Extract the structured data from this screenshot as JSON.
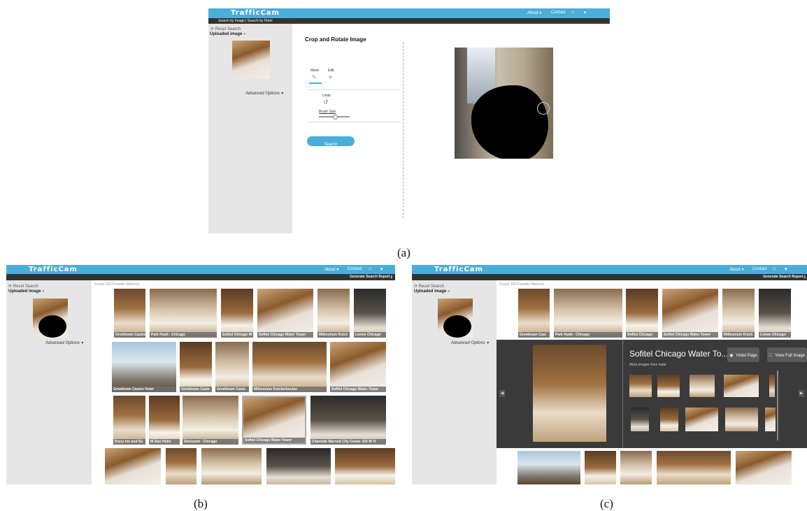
{
  "app": {
    "brand": "TrafficCam"
  },
  "nav": {
    "about": "About ▾",
    "contact": "Contact",
    "home_icon": "home-icon",
    "chevron": "▾"
  },
  "panel_a": {
    "subbar": "Search by Image | Search by Hotel",
    "reset": "Reset Search",
    "uploaded": "Uploaded image",
    "advanced": "Advanced Options",
    "heading": "Crop and Rotate Image",
    "tab_mask": "Mask",
    "tab_edit": "Edit",
    "undo": "Undo",
    "brush": "Brush Size",
    "search": "Search",
    "caption": "(a)"
  },
  "panel_b": {
    "report": "Generate Search Report",
    "reset": "Reset Search",
    "uploaded": "Uploaded image",
    "advanced": "Advanced Options",
    "found": "Found 100 Possible Matches",
    "caption": "(b)",
    "results": [
      "Greektown Casino",
      "Park Hyatt - Chicago",
      "Sofitel Chicago W",
      "Sofitel Chicago Water Tower",
      "Millennium Knick",
      "Loews Chicago",
      "Greektown Casino Hotel",
      "Greektown Casin",
      "Greektown Casin",
      "Millennium Knickerbocker",
      "Sofitel Chicago Water Tower",
      "Drury Inn and Su",
      "M-Star Hotel",
      "Swissotel - Chicago",
      "Sofitel Chicago Water Tower",
      "Charlotte Marriott City Center 100 W Tr"
    ]
  },
  "panel_c": {
    "report": "Generate Search Report",
    "reset": "Reset Search",
    "uploaded": "Uploaded image",
    "advanced": "Advanced Options",
    "found": "Found 100 Possible Matches",
    "caption": "(c)",
    "results": [
      "Greektown Casi",
      "Park Hyatt - Chicago",
      "Sofitel Chicago",
      "Sofitel Chicago Water Tower",
      "Millennium Knick",
      "Loews Chicago"
    ],
    "detail_title": "Sofitel Chicago Water To...",
    "more_images": "More images from hotel",
    "hotel_page": "Hotel Page",
    "view_full": "View Full Image"
  }
}
